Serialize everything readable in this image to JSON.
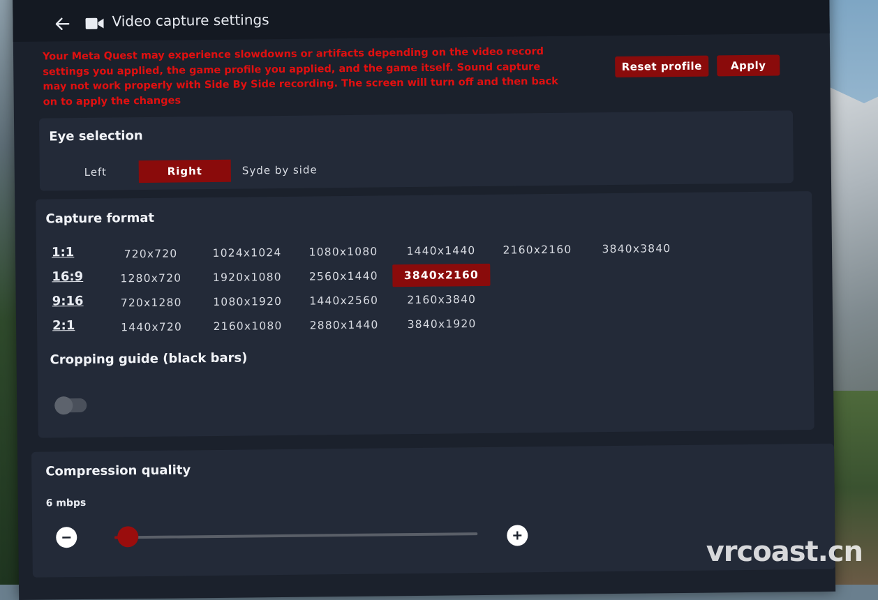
{
  "header": {
    "title": "Video capture settings"
  },
  "warning": "Your Meta Quest may experience slowdowns or artifacts depending on the video record settings you applied, the game profile you applied, and the game itself. Sound capture may not work properly with Side By Side recording. The screen will turn off and then back on to apply the changes",
  "actions": {
    "reset_label": "Reset profile",
    "apply_label": "Apply"
  },
  "eye_selection": {
    "title": "Eye selection",
    "options": [
      "Left",
      "Right",
      "Syde by side"
    ],
    "selected": "Right"
  },
  "capture_format": {
    "title": "Capture format",
    "rows": [
      {
        "ratio": "1:1",
        "resolutions": [
          "720x720",
          "1024x1024",
          "1080x1080",
          "1440x1440",
          "2160x2160",
          "3840x3840"
        ]
      },
      {
        "ratio": "16:9",
        "resolutions": [
          "1280x720",
          "1920x1080",
          "2560x1440",
          "3840x2160"
        ]
      },
      {
        "ratio": "9:16",
        "resolutions": [
          "720x1280",
          "1080x1920",
          "1440x2560",
          "2160x3840"
        ]
      },
      {
        "ratio": "2:1",
        "resolutions": [
          "1440x720",
          "2160x1080",
          "2880x1440",
          "3840x1920"
        ]
      }
    ],
    "selected": "3840x2160"
  },
  "cropping_guide": {
    "title": "Cropping guide (black bars)",
    "enabled": false
  },
  "compression": {
    "title": "Compression quality",
    "value_label": "6 mbps",
    "level": 0.02
  },
  "watermark": "vrcoast.cn",
  "colors": {
    "accent": "#8a0b0b",
    "warning": "#e01010",
    "panel": "#1b212c",
    "card": "#232a38"
  },
  "icons": {
    "back": "arrow-left-icon",
    "camera": "video-camera-icon",
    "minus": "minus-icon",
    "plus": "plus-icon"
  }
}
